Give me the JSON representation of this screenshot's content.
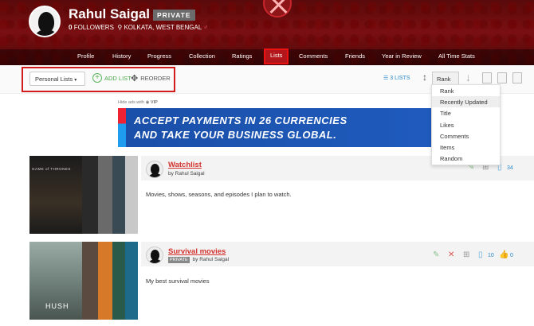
{
  "profile": {
    "name": "Rahul Saigal",
    "privacy": "PRIVATE",
    "followers_count": "0",
    "followers_label": "FOLLOWERS",
    "location": "KOLKATA, WEST BENGAL",
    "gender_symbol": "♂"
  },
  "nav": [
    "Profile",
    "History",
    "Progress",
    "Collection",
    "Ratings",
    "Lists",
    "Comments",
    "Friends",
    "Year in Review",
    "All Time Stats"
  ],
  "nav_active": "Lists",
  "toolbar": {
    "filter_value": "Personal Lists",
    "add_list_label": "ADD LIST",
    "reorder_label": "REORDER",
    "lists_count": "3 LISTS",
    "sort_value": "Rank"
  },
  "sort_menu": {
    "options": [
      "Rank",
      "Recently Updated",
      "Title",
      "Likes",
      "Comments",
      "Items",
      "Random"
    ],
    "selected": "Recently Updated"
  },
  "ad": {
    "hide_label": "Hide ads with",
    "vip_label": "VIP",
    "line1": "ACCEPT PAYMENTS IN 26 CURRENCIES",
    "line2": "AND TAKE YOUR BUSINESS GLOBAL."
  },
  "lists": [
    {
      "title": "Watchlist",
      "by": "by Rahul Saigal",
      "description": "Movies, shows, seasons, and episodes I plan to watch.",
      "item_count": "34",
      "poster_text": "GAME of THRONES",
      "poster_colors": [
        "#1b1b1b",
        "#2a2a2a",
        "#6a6a6a",
        "#3a4a55",
        "#c8c8c8"
      ]
    },
    {
      "title": "Survival movies",
      "badge": "PRIVATE",
      "by": "by Rahul Saigal",
      "description": "My best survival movies",
      "item_count": "10",
      "like_count": "0",
      "poster_text": "HUSH",
      "poster_colors": [
        "#7a8a85",
        "#5a4a40",
        "#d67a2a",
        "#2a5a4a",
        "#1e6a8a"
      ]
    }
  ]
}
